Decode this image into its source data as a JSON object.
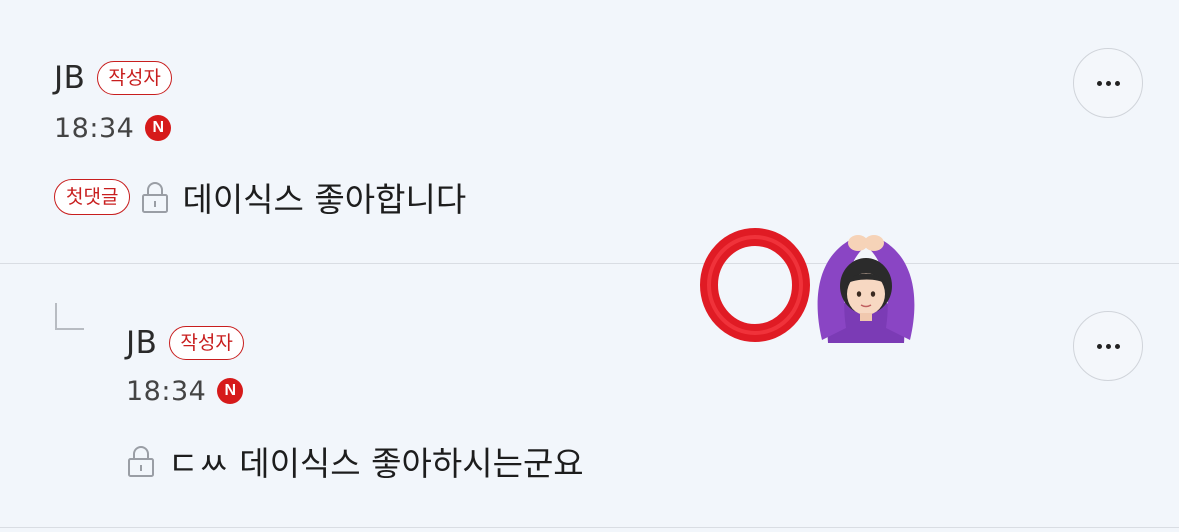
{
  "comments": [
    {
      "author": "JB",
      "author_badge": "작성자",
      "time": "18:34",
      "n_badge": "N",
      "first_badge": "첫댓글",
      "text": "데이식스 좋아합니다"
    },
    {
      "author": "JB",
      "author_badge": "작성자",
      "time": "18:34",
      "n_badge": "N",
      "text": "ㄷㅆ 데이식스 좋아하시는군요"
    }
  ],
  "icons": {
    "more": "more-dots-icon",
    "lock": "lock-icon",
    "reply": "reply-arrow-icon",
    "overlay_circle": "red-circle-o-emoji",
    "overlay_person": "person-gesturing-ok-emoji"
  },
  "colors": {
    "background": "#f2f6fb",
    "accent_red": "#c81e1e",
    "n_badge": "#d61a1a",
    "divider": "#d9dde3",
    "person_top": "#7b3bb5"
  }
}
